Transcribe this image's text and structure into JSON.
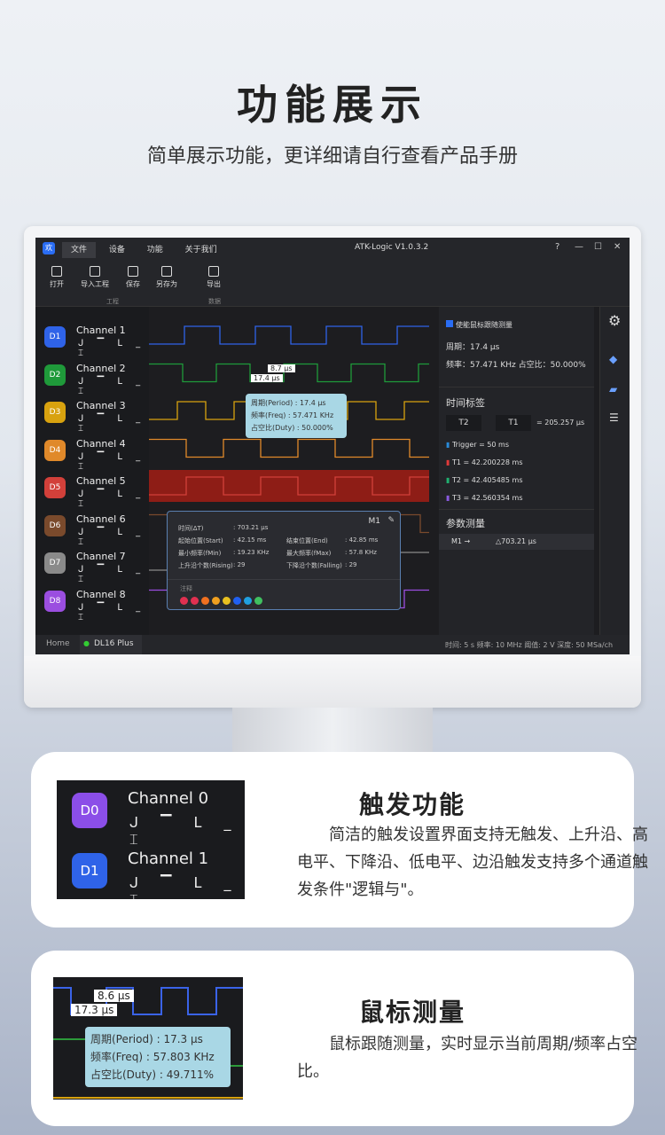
{
  "header": {
    "title": "功能展示",
    "subtitle": "简单展示功能，更详细请自行查看产品手册"
  },
  "app": {
    "logo": "欢",
    "menu": [
      "文件",
      "设备",
      "功能",
      "关于我们"
    ],
    "title": "ATK-Logic  V1.0.3.2",
    "window_buttons": [
      "?",
      "—",
      "☐",
      "✕"
    ],
    "toolbar": [
      {
        "label": "打开",
        "icon": "folder-icon"
      },
      {
        "label": "导入工程",
        "icon": "import-icon"
      },
      {
        "label": "保存",
        "icon": "save-icon"
      },
      {
        "label": "另存为",
        "icon": "save-as-icon"
      },
      {
        "label": "导出",
        "icon": "export-icon"
      }
    ],
    "toolbar_groups": [
      "工程",
      "数据"
    ],
    "channels": [
      {
        "id": "D1",
        "name": "Channel 1",
        "color": "#2f63e8"
      },
      {
        "id": "D2",
        "name": "Channel 2",
        "color": "#1f9a3a"
      },
      {
        "id": "D3",
        "name": "Channel 3",
        "color": "#d8a20f"
      },
      {
        "id": "D4",
        "name": "Channel 4",
        "color": "#e0892a"
      },
      {
        "id": "D5",
        "name": "Channel 5",
        "color": "#d2403a"
      },
      {
        "id": "D6",
        "name": "Channel 6",
        "color": "#7a4a2c"
      },
      {
        "id": "D7",
        "name": "Channel 7",
        "color": "#8a8a8a"
      },
      {
        "id": "D8",
        "name": "Channel 8",
        "color": "#9b4ee0"
      }
    ],
    "trigger_symbols": "ᒍ ▔ ᒪ _ ⌶",
    "cursor_labels": [
      "8.7 μs",
      "17.4 μs"
    ],
    "hover_popup": {
      "period": "周期(Period)   : 17.4 μs",
      "freq": "频率(Freq)      : 57.471 KHz",
      "duty": "占空比(Duty)   : 50.000%"
    },
    "measure": {
      "title": "M1",
      "rows": [
        [
          "时间(ΔT)",
          ": 703.21 μs",
          "",
          ""
        ],
        [
          "起始位置(Start)",
          ": 42.15 ms",
          "结束位置(End)",
          ": 42.85 ms"
        ],
        [
          "最小频率(fMin)",
          ": 19.23 KHz",
          "最大频率(fMax)",
          ": 57.8 KHz"
        ],
        [
          "上升沿个数(Rising)",
          ": 29",
          "下降沿个数(Falling)",
          ": 29"
        ]
      ],
      "note_label": "注释",
      "swatches": [
        "#e03050",
        "#e03050",
        "#f07020",
        "#f0a020",
        "#e8c020",
        "#2060f0",
        "#20a0e0",
        "#40c060"
      ]
    },
    "side": {
      "follow_label": "使能鼠标跟随测量",
      "period": "周期：17.4 μs",
      "freq": "频率：57.471 KHz  占空比：50.000%",
      "time_tags_title": "时间标签",
      "tag_a": "T2",
      "tag_b": "T1",
      "tag_diff": "= 205.257 μs",
      "tags": [
        {
          "label": "Trigger = 50 ms",
          "color": "#2a8ad8"
        },
        {
          "label": "T1 = 42.200228 ms",
          "color": "#e03a3a"
        },
        {
          "label": "T2 = 42.405485 ms",
          "color": "#20b070"
        },
        {
          "label": "T3 = 42.560354 ms",
          "color": "#8a5ae0"
        }
      ],
      "param_title": "参数测量",
      "param_row": "M1 →",
      "param_value": "△703.21 μs"
    },
    "status": {
      "home": "Home",
      "device": "DL16 Plus",
      "info": "时间: 5 s   频率: 10 MHz   阈值: 2 V   深度: 50 MSa/ch"
    }
  },
  "cards": [
    {
      "title": "触发功能",
      "text": "　　简洁的触发设置界面支持无触发、上升沿、高电平、下降沿、低电平、边沿触发支持多个通道触发条件\"逻辑与\"。",
      "thumb": {
        "channels": [
          {
            "id": "D0",
            "name": "Channel 0",
            "color": "#8b4ee8"
          },
          {
            "id": "D1",
            "name": "Channel 1",
            "color": "#2f63e8"
          }
        ]
      }
    },
    {
      "title": "鼠标测量",
      "text": "　　鼠标跟随测量，实时显示当前周期/频率占空比。",
      "thumb": {
        "cursor_labels": [
          "8.6 μs",
          "17.3 μs"
        ],
        "period": "周期(Period)   : 17.3 μs",
        "freq": "频率(Freq)      : 57.803 KHz",
        "duty": "占空比(Duty)   : 49.711%"
      }
    }
  ]
}
